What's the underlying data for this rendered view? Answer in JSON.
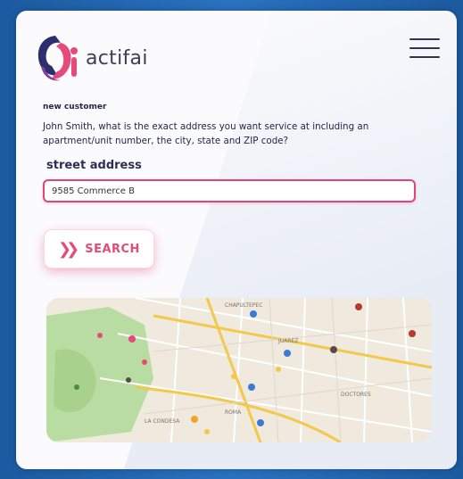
{
  "brand": {
    "name": "actifai",
    "colors": {
      "accent": "#e54b7a",
      "dark": "#2f3550",
      "bg": "#1e5fa6"
    }
  },
  "form": {
    "section_title": "new customer",
    "prompt": "John Smith, what is the exact address you want service at including an apartment/unit number, the city, state and ZIP code?",
    "field_label": "street address",
    "field_value": "9585 Commerce B"
  },
  "search_button": {
    "label": "SEARCH",
    "icon": "double-chevron-right-icon"
  },
  "map": {
    "labels": [
      "CHAPULTEPEC",
      "DOCTORES",
      "LA CONDESA",
      "ROMA",
      "JUAREZ"
    ]
  }
}
